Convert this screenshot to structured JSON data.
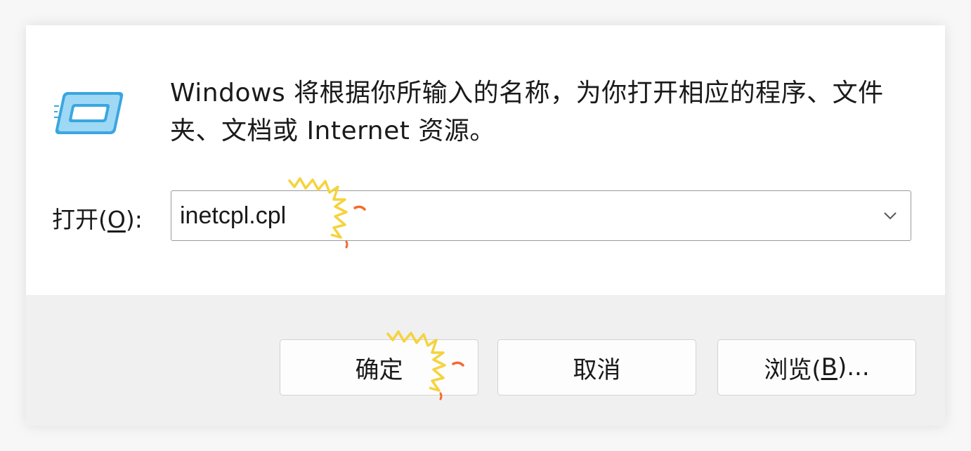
{
  "dialog": {
    "description": "Windows 将根据你所输入的名称，为你打开相应的程序、文件夹、文档或 Internet 资源。",
    "icon": "run-window-icon"
  },
  "open": {
    "label_prefix": "打开(",
    "label_accel": "O",
    "label_suffix": "):",
    "value": "inetcpl.cpl"
  },
  "buttons": {
    "ok_label": "确定",
    "cancel_label": "取消",
    "browse_prefix": "浏览(",
    "browse_accel": "B",
    "browse_suffix": ")..."
  },
  "colors": {
    "icon_blue": "#3aa6e0",
    "icon_light": "#9fd8f5",
    "sparkle_yellow": "#f5d33d",
    "sparkle_orange": "#f26a2e"
  }
}
